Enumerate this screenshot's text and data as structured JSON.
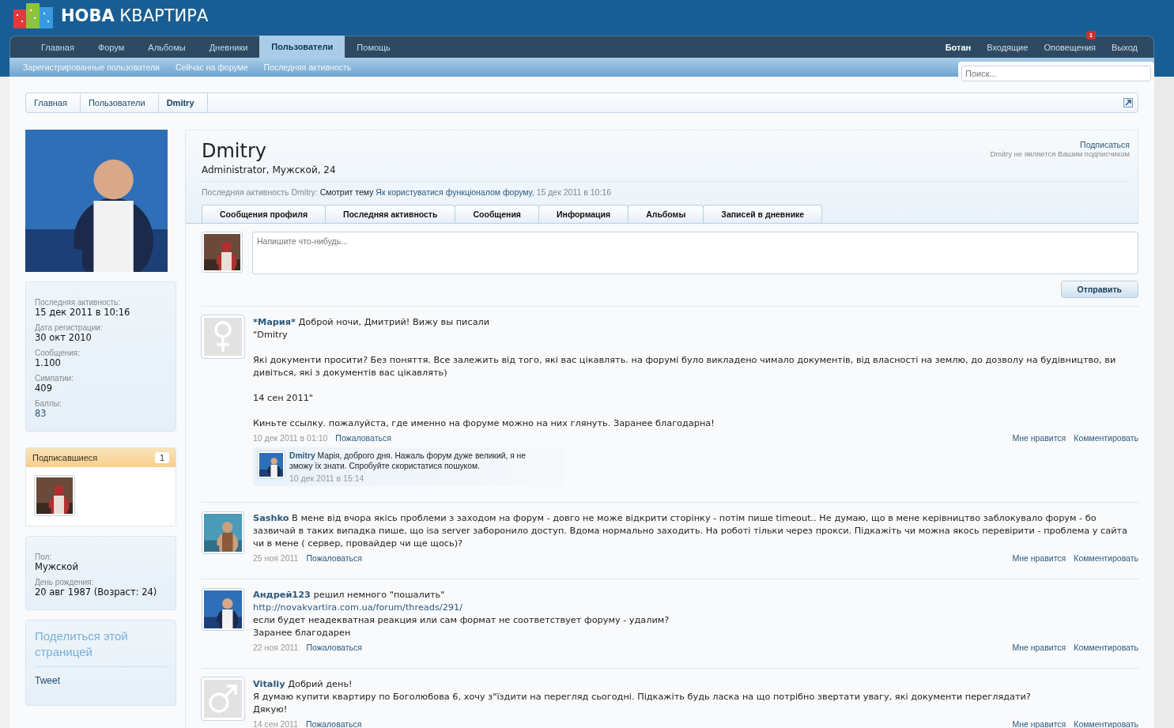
{
  "site": {
    "logo_bold": "НОВА",
    "logo_rest": "КВАРТИРА"
  },
  "nav": {
    "tabs": [
      {
        "label": "Главная",
        "selected": false
      },
      {
        "label": "Форум",
        "selected": false
      },
      {
        "label": "Альбомы",
        "selected": false
      },
      {
        "label": "Дневники",
        "selected": false
      },
      {
        "label": "Пользователи",
        "selected": true
      },
      {
        "label": "Помощь",
        "selected": false
      }
    ],
    "user_links": [
      {
        "label": "Ботан",
        "kind": "user"
      },
      {
        "label": "Входящие",
        "kind": "link"
      },
      {
        "label": "Оповещения",
        "kind": "alerts",
        "badge": "1"
      },
      {
        "label": "Выход",
        "kind": "link"
      }
    ],
    "sub_tabs": [
      "Зарегистрированные пользователи",
      "Сейчас на форуме",
      "Последняя активность"
    ],
    "search": {
      "placeholder": "Поиск..."
    }
  },
  "breadcrumb": [
    {
      "label": "Главная",
      "current": false
    },
    {
      "label": "Пользователи",
      "current": false
    },
    {
      "label": "Dmitry",
      "current": true
    }
  ],
  "sidebar": {
    "avatar": {
      "kind": "picture"
    },
    "stats": [
      {
        "label": "Последняя активность:",
        "value": "15 дек 2011 в 10:16",
        "link": false
      },
      {
        "label": "Дата регистрации:",
        "value": "30 окт 2010",
        "link": false
      },
      {
        "label": "Сообщения:",
        "value": "1.100",
        "link": false
      },
      {
        "label": "Симпатии:",
        "value": "409",
        "link": false
      },
      {
        "label": "Баллы:",
        "value": "83",
        "link": true
      }
    ],
    "followers": {
      "title": "Подписавшиеся",
      "count": "1"
    },
    "details": [
      {
        "label": "Пол:",
        "value": "Мужской"
      },
      {
        "label": "День рождения:",
        "value": "20 авг 1987 (Возраст: 24)"
      }
    ],
    "share": {
      "title": "Поделиться этой страницей",
      "tweet": "Tweet"
    }
  },
  "profile": {
    "name": "Dmitry",
    "info": "Administrator, Мужской, 24",
    "follow": "Подписаться",
    "follow_note": "Dmitry не является Вашим подписчиком",
    "activity": {
      "label": "Последняя активность Dmitry:",
      "action": "Смотрит тему",
      "topic": "Як користуватися функціоналом форуму",
      "time": ", 15 дек 2011 в 10:16"
    },
    "tabs": [
      {
        "label": "Сообщения профиля",
        "selected": false
      },
      {
        "label": "Последняя активность",
        "selected": false
      },
      {
        "label": "Сообщения",
        "selected": false
      },
      {
        "label": "Информация",
        "selected": false
      },
      {
        "label": "Альбомы",
        "selected": false
      },
      {
        "label": "Записей в дневнике",
        "selected": false
      }
    ]
  },
  "composer": {
    "placeholder": "Напишите что-нибудь...",
    "submit": "Отправить"
  },
  "posts": [
    {
      "author": "*Мария*",
      "avatar": {
        "kind": "female"
      },
      "paragraphs": [
        [
          {
            "kind": "text",
            "text": "Доброй ночи, Дмитрий! Вижу вы писали"
          },
          {
            "kind": "text",
            "text": "\"Dmitry"
          }
        ],
        [
          {
            "kind": "text",
            "text": "Які документи просити? Без поняття. Все залежить від того, які вас цікавлять. на форумі було викладено чимало документів, від власності на землю, до дозволу на будівництво, ви дивіться, які з документів вас цікавлять)"
          }
        ],
        [
          {
            "kind": "text",
            "text": "14 сен 2011\""
          }
        ],
        [
          {
            "kind": "text",
            "text": "Киньте ссылку. пожалуйста, где именно на форуме можно на них глянуть. Заранее благодарна!"
          }
        ]
      ],
      "date": "10 дек 2011 в 01:10",
      "report": "Пожаловаться",
      "like": "Мне нравится",
      "comment": "Комментировать",
      "comments": [
        {
          "author": "Dmitry",
          "avatar": {
            "kind": "picture"
          },
          "text": "Марія, доброго дня. Нажаль форум дуже великий, я не зможу їх знати. Спробуйте скористатися пошуком.",
          "date": "10 дек 2011 в 15:14"
        }
      ]
    },
    {
      "author": "Sashko",
      "avatar": {
        "kind": "picture"
      },
      "paragraphs": [
        [
          {
            "kind": "text",
            "text": "В мене від вчора якісь проблеми з заходом на форум - довго не може відкрити сторінку - потім пише timeout.. Не думаю, що в мене керівництво заблокувало форум - бо зазвичай в таких випадка пише, що isa server заборонило доступ. Вдома нормально заходить. На роботі тільки через прокси. Підкажіть чи можна якось перевірити - проблема у сайта чи в мене ( сервер, провайдер чи ще щось)?"
          }
        ]
      ],
      "date": "25 ноя 2011",
      "report": "Пожаловаться",
      "like": "Мне нравится",
      "comment": "Комментировать"
    },
    {
      "author": "Андрей123",
      "avatar": {
        "kind": "picture"
      },
      "paragraphs": [
        [
          {
            "kind": "text",
            "text": "решил немного \"пошалить\""
          },
          {
            "kind": "link",
            "text": "http://novakvartira.com.ua/forum/threads/291/"
          },
          {
            "kind": "text",
            "text": "если будет неадекватная реакция или сам формат не соответствует форуму - удалим?"
          },
          {
            "kind": "text",
            "text": "Заранее благодарен"
          }
        ]
      ],
      "date": "22 ноя 2011",
      "report": "Пожаловаться",
      "like": "Мне нравится",
      "comment": "Комментировать"
    },
    {
      "author": "Vitaliy",
      "avatar": {
        "kind": "male"
      },
      "paragraphs": [
        [
          {
            "kind": "text",
            "text": "Добрий день!"
          },
          {
            "kind": "text",
            "text": "Я думаю купити квартиру по Боголюбова 6, хочу з\"їздити на перегляд сьогодні. Підкажіть будь ласка на що потрібно звертати увагу, які документи переглядати?"
          },
          {
            "kind": "text",
            "text": "Дякую!"
          }
        ]
      ],
      "date": "14 сен 2011",
      "report": "Пожаловаться",
      "like": "Мне нравится",
      "comment": "Комментировать"
    }
  ]
}
